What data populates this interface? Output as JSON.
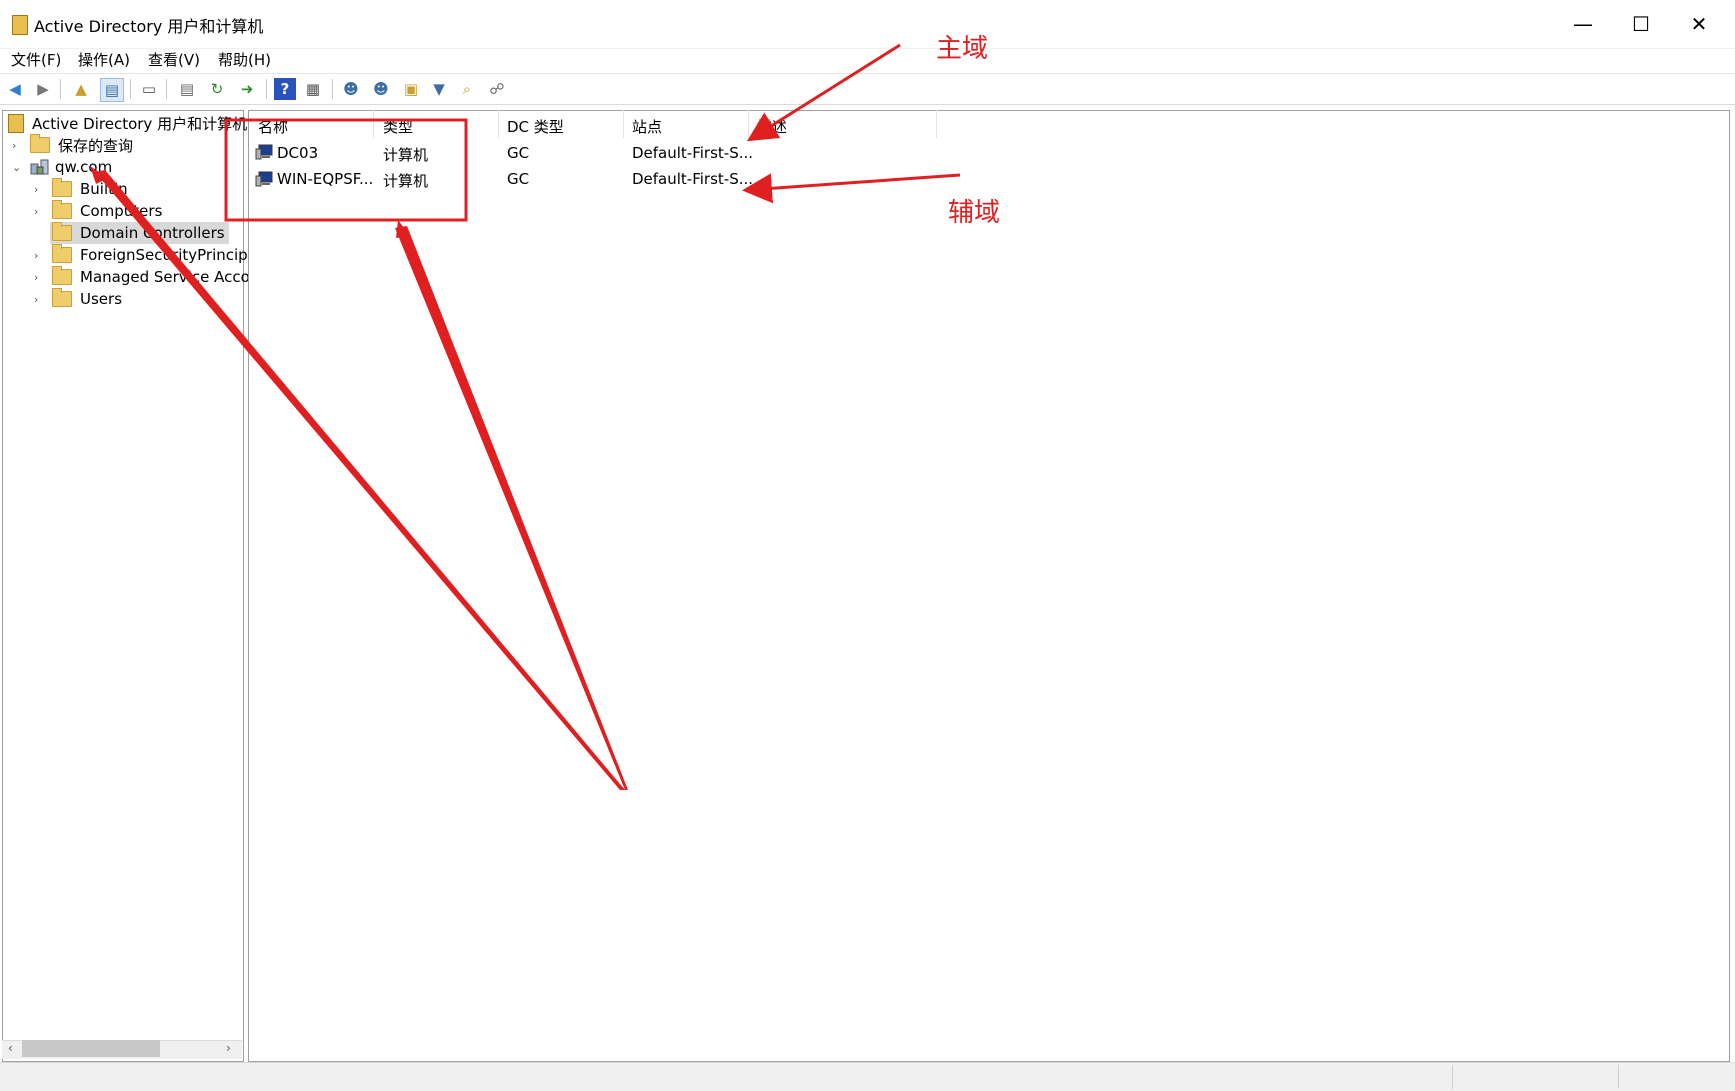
{
  "window": {
    "title": "Active Directory 用户和计算机",
    "minimize": "—",
    "maximize": "☐",
    "close": "✕"
  },
  "menu": [
    "文件(F)",
    "操作(A)",
    "查看(V)",
    "帮助(H)"
  ],
  "tree": {
    "root": "Active Directory 用户和计算机 [",
    "saved_queries": "保存的查询",
    "domain": "qw.com",
    "children": [
      "Builtin",
      "Computers",
      "Domain Controllers",
      "ForeignSecurityPrincipal",
      "Managed Service Accou",
      "Users"
    ],
    "selected": "Domain Controllers"
  },
  "list": {
    "columns": [
      "名称",
      "类型",
      "DC 类型",
      "站点",
      "描述"
    ],
    "rows": [
      {
        "name": "DC03",
        "type": "计算机",
        "dc_type": "GC",
        "site": "Default-First-S..."
      },
      {
        "name": "WIN-EQPSF...",
        "type": "计算机",
        "dc_type": "GC",
        "site": "Default-First-S..."
      }
    ]
  },
  "annotations": {
    "primary": "主域",
    "secondary": "辅域",
    "color": "#e02020"
  }
}
